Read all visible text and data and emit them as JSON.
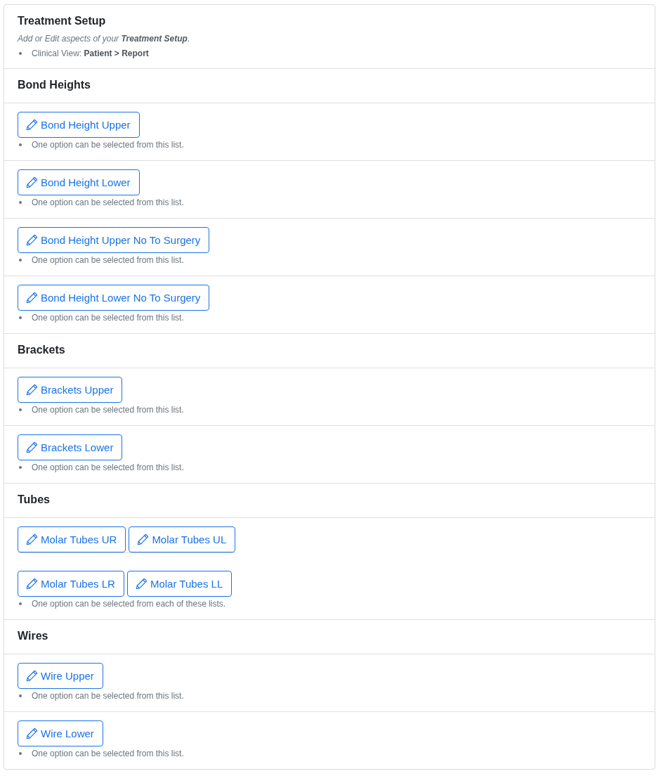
{
  "header": {
    "title": "Treatment Setup",
    "description": "Add or Edit aspects of your **Treatment Setup**.",
    "bullets": [
      "Clinical View: **Patient > Report**"
    ]
  },
  "sections": [
    {
      "title": "Bond Heights",
      "items": [
        {
          "rows": [
            [
              "Bond Height Upper"
            ]
          ],
          "note": "One option can be selected from this list."
        },
        {
          "rows": [
            [
              "Bond Height Lower"
            ]
          ],
          "note": "One option can be selected from this list."
        },
        {
          "rows": [
            [
              "Bond Height Upper No To Surgery"
            ]
          ],
          "note": "One option can be selected from this list."
        },
        {
          "rows": [
            [
              "Bond Height Lower No To Surgery"
            ]
          ],
          "note": "One option can be selected from this list."
        }
      ]
    },
    {
      "title": "Brackets",
      "items": [
        {
          "rows": [
            [
              "Brackets Upper"
            ]
          ],
          "note": "One option can be selected from this list."
        },
        {
          "rows": [
            [
              "Brackets Lower"
            ]
          ],
          "note": "One option can be selected from this list."
        }
      ]
    },
    {
      "title": "Tubes",
      "items": [
        {
          "rows": [
            [
              "Molar Tubes UR",
              "Molar Tubes UL"
            ],
            [
              "Molar Tubes LR",
              "Molar Tubes LL"
            ]
          ],
          "note": "One option can be selected from each of these lists."
        }
      ]
    },
    {
      "title": "Wires",
      "items": [
        {
          "rows": [
            [
              "Wire Upper"
            ]
          ],
          "note": "One option can be selected from this list."
        },
        {
          "rows": [
            [
              "Wire Lower"
            ]
          ],
          "note": "One option can be selected from this list."
        }
      ]
    }
  ]
}
